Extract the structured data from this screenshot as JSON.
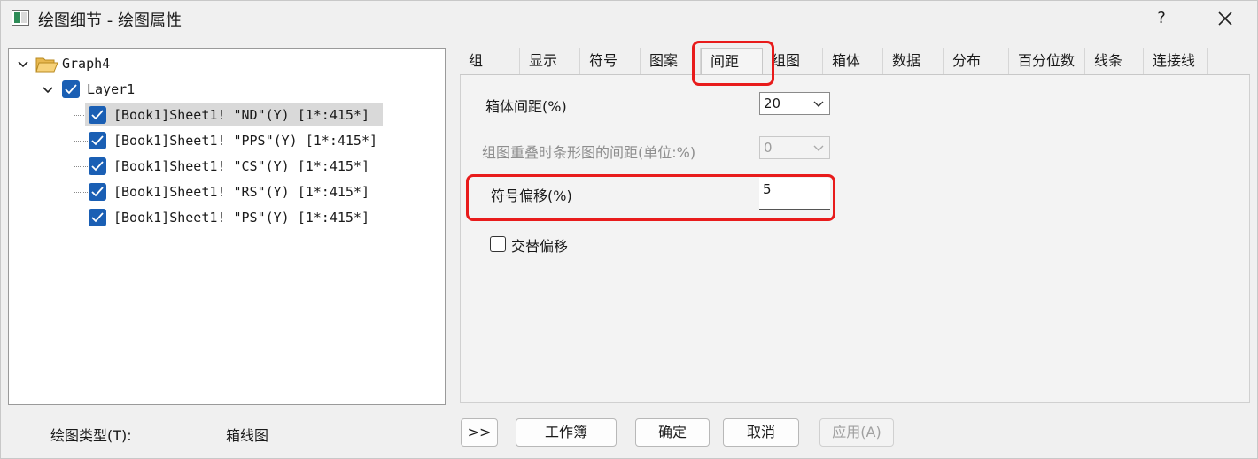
{
  "window": {
    "title": "绘图细节 - 绘图属性",
    "help_label": "?"
  },
  "tree": {
    "root": "Graph4",
    "layer": "Layer1",
    "items": [
      "[Book1]Sheet1! \"ND\"(Y) [1*:415*]",
      "[Book1]Sheet1! \"PPS\"(Y) [1*:415*]",
      "[Book1]Sheet1! \"CS\"(Y) [1*:415*]",
      "[Book1]Sheet1! \"RS\"(Y) [1*:415*]",
      "[Book1]Sheet1! \"PS\"(Y) [1*:415*]"
    ]
  },
  "plot_type": {
    "label": "绘图类型(T):",
    "value": "箱线图"
  },
  "tabs": [
    "组",
    "显示",
    "符号",
    "图案",
    "间距",
    "组图",
    "箱体",
    "数据",
    "分布",
    "百分位数",
    "线条",
    "连接线"
  ],
  "active_tab": "间距",
  "fields": {
    "box_gap_label": "箱体间距(%)",
    "box_gap_value": "20",
    "overlap_gap_label": "组图重叠时条形图的间距(单位:%)",
    "overlap_gap_value": "0",
    "symbol_offset_label": "符号偏移(%)",
    "symbol_offset_value": "5",
    "alternate_offset_label": "交替偏移"
  },
  "buttons": {
    "expand": ">>",
    "workbook": "工作簿",
    "ok": "确定",
    "cancel": "取消",
    "apply": "应用(A)"
  },
  "colors": {
    "checkbox": "#1a5fb4",
    "highlight": "#e81b1b"
  }
}
